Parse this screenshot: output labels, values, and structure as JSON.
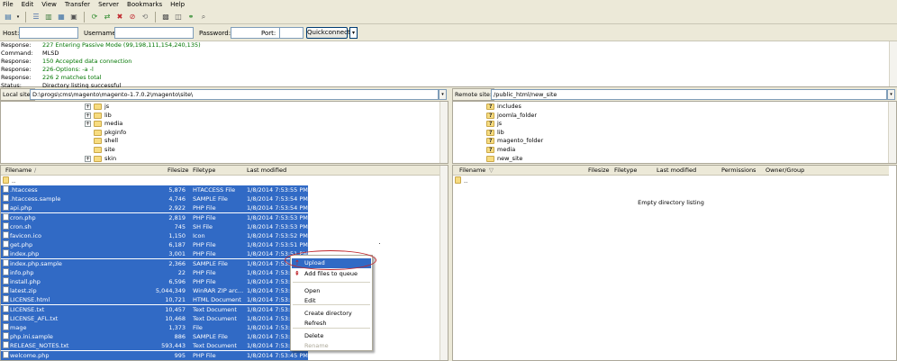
{
  "menu": [
    "File",
    "Edit",
    "View",
    "Transfer",
    "Server",
    "Bookmarks",
    "Help"
  ],
  "toolbar_icons": [
    "site-manager-icon",
    "dropdown-icon",
    "toggle-log-icon",
    "toggle-local-tree-icon",
    "toggle-remote-tree-icon",
    "toggle-queue-icon",
    "refresh-icon",
    "process-queue-icon",
    "cancel-icon",
    "disconnect-icon",
    "reconnect-icon",
    "directory-listing-filters-icon",
    "compare-icon",
    "sync-browsing-icon",
    "search-icon"
  ],
  "quickconnect": {
    "host_label": "Host:",
    "username_label": "Username:",
    "password_label": "Password:",
    "port_label": "Port:",
    "button": "Quickconnect",
    "arrow": "▾"
  },
  "log": [
    {
      "key": "Response:",
      "value": "227 Entering Passive Mode (99,198,111,154,240,135)",
      "color": "green"
    },
    {
      "key": "Command:",
      "value": "MLSD",
      "color": "black"
    },
    {
      "key": "Response:",
      "value": "150 Accepted data connection",
      "color": "green"
    },
    {
      "key": "Response:",
      "value": "226-Options: -a -l",
      "color": "green"
    },
    {
      "key": "Response:",
      "value": "226 2 matches total",
      "color": "green"
    },
    {
      "key": "Status:",
      "value": "Directory listing successful",
      "color": "black"
    }
  ],
  "local": {
    "label": "Local site:",
    "path": "D:\\progs\\cms\\magento\\magento-1.7.0.2\\magento\\site\\",
    "tree": [
      {
        "name": "js",
        "expander": "+"
      },
      {
        "name": "lib",
        "expander": "+"
      },
      {
        "name": "media",
        "expander": "+"
      },
      {
        "name": "pkginfo",
        "expander": ""
      },
      {
        "name": "shell",
        "expander": ""
      },
      {
        "name": "site",
        "expander": ""
      },
      {
        "name": "skin",
        "expander": "+"
      }
    ],
    "columns": [
      "Filename",
      "/",
      "Filesize",
      "Filetype",
      "Last modified"
    ],
    "parent_row": "..",
    "files": [
      {
        "name": ".htaccess",
        "size": "5,876",
        "type": "HTACCESS File",
        "modified": "1/8/2014 7:53:55 PM"
      },
      {
        "name": ".htaccess.sample",
        "size": "4,746",
        "type": "SAMPLE File",
        "modified": "1/8/2014 7:53:54 PM"
      },
      {
        "name": "api.php",
        "size": "2,922",
        "type": "PHP File",
        "modified": "1/8/2014 7:53:54 PM"
      },
      {
        "name": "cron.php",
        "size": "2,819",
        "type": "PHP File",
        "modified": "1/8/2014 7:53:53 PM"
      },
      {
        "name": "cron.sh",
        "size": "745",
        "type": "SH File",
        "modified": "1/8/2014 7:53:53 PM"
      },
      {
        "name": "favicon.ico",
        "size": "1,150",
        "type": "Icon",
        "modified": "1/8/2014 7:53:52 PM"
      },
      {
        "name": "get.php",
        "size": "6,187",
        "type": "PHP File",
        "modified": "1/8/2014 7:53:51 PM"
      },
      {
        "name": "index.php",
        "size": "3,001",
        "type": "PHP File",
        "modified": "1/8/2014 7:53:51 PM"
      },
      {
        "name": "index.php.sample",
        "size": "2,366",
        "type": "SAMPLE File",
        "modified": "1/8/2014 7:53:5"
      },
      {
        "name": "info.php",
        "size": "22",
        "type": "PHP File",
        "modified": "1/8/2014 7:53:5"
      },
      {
        "name": "install.php",
        "size": "6,596",
        "type": "PHP File",
        "modified": "1/8/2014 7:53:4"
      },
      {
        "name": "latest.zip",
        "size": "5,044,349",
        "type": "WinRAR ZIP arc...",
        "modified": "1/8/2014 7:53:4"
      },
      {
        "name": "LICENSE.html",
        "size": "10,721",
        "type": "HTML Document",
        "modified": "1/8/2014 7:53:4"
      },
      {
        "name": "LICENSE.txt",
        "size": "10,457",
        "type": "Text Document",
        "modified": "1/8/2014 7:53:4"
      },
      {
        "name": "LICENSE_AFL.txt",
        "size": "10,468",
        "type": "Text Document",
        "modified": "1/8/2014 7:53:4"
      },
      {
        "name": "mage",
        "size": "1,373",
        "type": "File",
        "modified": "1/8/2014 7:53:4"
      },
      {
        "name": "php.ini.sample",
        "size": "886",
        "type": "SAMPLE File",
        "modified": "1/8/2014 7:53:4"
      },
      {
        "name": "RELEASE_NOTES.txt",
        "size": "593,443",
        "type": "Text Document",
        "modified": "1/8/2014 7:53:4"
      },
      {
        "name": "welcome.php",
        "size": "995",
        "type": "PHP File",
        "modified": "1/8/2014 7:53:45 PM"
      }
    ]
  },
  "remote": {
    "label": "Remote site:",
    "path": "/public_html/new_site",
    "tree": [
      {
        "name": "includes"
      },
      {
        "name": "joomla_folder"
      },
      {
        "name": "js"
      },
      {
        "name": "lib"
      },
      {
        "name": "magento_folder"
      },
      {
        "name": "media"
      },
      {
        "name": "new_site"
      }
    ],
    "columns": [
      "Filename",
      "Filesize",
      "Filetype",
      "Last modified",
      "Permissions",
      "Owner/Group"
    ],
    "parent_row": "..",
    "empty_text": "Empty directory listing"
  },
  "context_menu": [
    {
      "label": "Upload",
      "state": "highlight",
      "icon": "upload-icon"
    },
    {
      "label": "Add files to queue",
      "state": "normal",
      "icon": "add-queue-icon"
    },
    {
      "label": "Open",
      "state": "normal"
    },
    {
      "label": "Edit",
      "state": "normal"
    },
    {
      "label": "Create directory",
      "state": "normal"
    },
    {
      "label": "Refresh",
      "state": "normal"
    },
    {
      "label": "Delete",
      "state": "normal"
    },
    {
      "label": "Rename",
      "state": "disabled"
    }
  ],
  "colors": {
    "selection": "#316ac5",
    "log_green": "#007500",
    "annotation_red": "#c0272d"
  }
}
